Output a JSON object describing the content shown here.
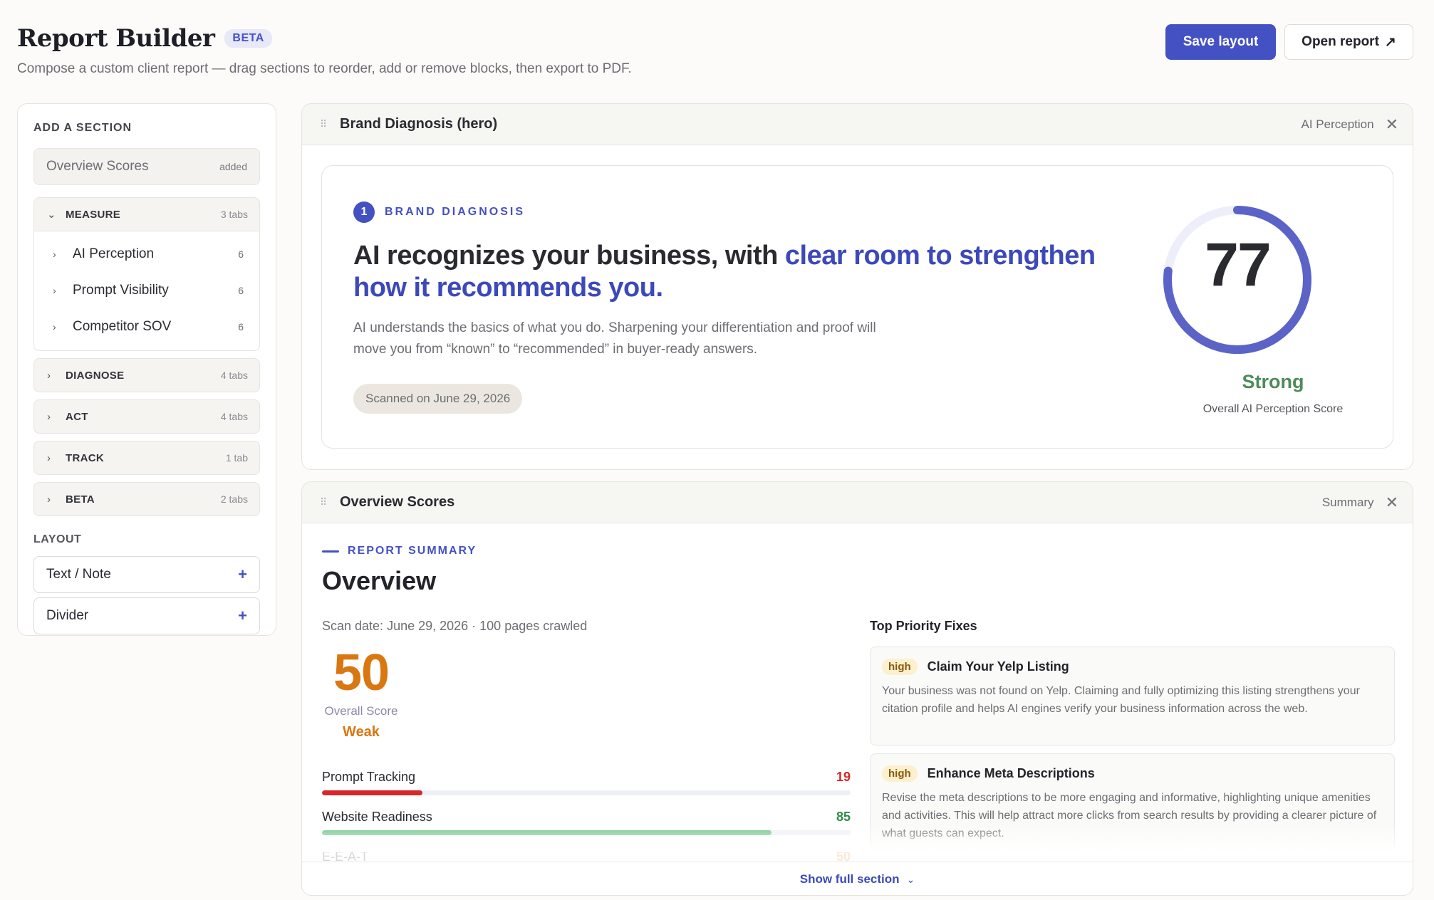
{
  "header": {
    "title": "Report Builder",
    "badge": "BETA",
    "subtitle": "Compose a custom client report — drag sections to reorder, add or remove blocks, then export to PDF.",
    "save_label": "Save layout",
    "open_label": "Open report",
    "open_icon": "↗"
  },
  "sidebar": {
    "heading": "ADD A SECTION",
    "added_item": {
      "label": "Overview Scores",
      "tag": "added"
    },
    "groups": [
      {
        "name": "MEASURE",
        "count": "3 tabs",
        "expanded": true,
        "items": [
          {
            "label": "AI Perception",
            "count": "6"
          },
          {
            "label": "Prompt Visibility",
            "count": "6"
          },
          {
            "label": "Competitor SOV",
            "count": "6"
          }
        ]
      },
      {
        "name": "DIAGNOSE",
        "count": "4 tabs",
        "expanded": false
      },
      {
        "name": "ACT",
        "count": "4 tabs",
        "expanded": false
      },
      {
        "name": "TRACK",
        "count": "1 tab",
        "expanded": false
      },
      {
        "name": "BETA",
        "count": "2 tabs",
        "expanded": false
      }
    ],
    "layout_heading": "LAYOUT",
    "layout_items": [
      {
        "label": "Text / Note",
        "icon": "+"
      },
      {
        "label": "Divider",
        "icon": "+"
      }
    ]
  },
  "brand_card": {
    "title": "Brand Diagnosis (hero)",
    "kind": "AI Perception",
    "step": "1",
    "kicker": "BRAND DIAGNOSIS",
    "headline_plain": "AI recognizes your business, with ",
    "headline_accent": "clear room to strengthen how it recommends you.",
    "body": "AI understands the basics of what you do. Sharpening your differentiation and proof will move you from “known” to “recommended” in buyer-ready answers.",
    "scan_pill": "Scanned on June 29, 2026",
    "score": "77",
    "score_max": 100,
    "rating": "Strong",
    "caption": "Overall AI Perception Score",
    "gauge_color": "#5b64c6",
    "track_color": "#eeeefa"
  },
  "overview_card": {
    "title": "Overview Scores",
    "kind": "Summary",
    "kicker": "REPORT SUMMARY",
    "heading": "Overview",
    "meta": "Scan date: June 29, 2026 · 100 pages crawled",
    "score": "50",
    "score_label": "Overall Score",
    "rating": "Weak",
    "bars": [
      {
        "name": "Prompt Tracking",
        "value": "19",
        "pct": 19,
        "color": "#d8262b"
      },
      {
        "name": "Website Readiness",
        "value": "85",
        "pct": 85,
        "color": "#6ec48a",
        "value_color": "#2f8a48"
      },
      {
        "name": "E-E-A-T",
        "value": "50",
        "pct": 50,
        "color": "#e3892a"
      }
    ],
    "fixes_heading": "Top Priority Fixes",
    "fixes": [
      {
        "priority": "high",
        "title": "Claim Your Yelp Listing",
        "desc": "Your business was not found on Yelp. Claiming and fully optimizing this listing strengthens your citation profile and helps AI engines verify your business information across the web."
      },
      {
        "priority": "high",
        "title": "Enhance Meta Descriptions",
        "desc": "Revise the meta descriptions to be more engaging and informative, highlighting unique amenities and activities. This will help attract more clicks from search results by providing a clearer picture of what guests can expect."
      }
    ],
    "show_more": "Show full section"
  }
}
